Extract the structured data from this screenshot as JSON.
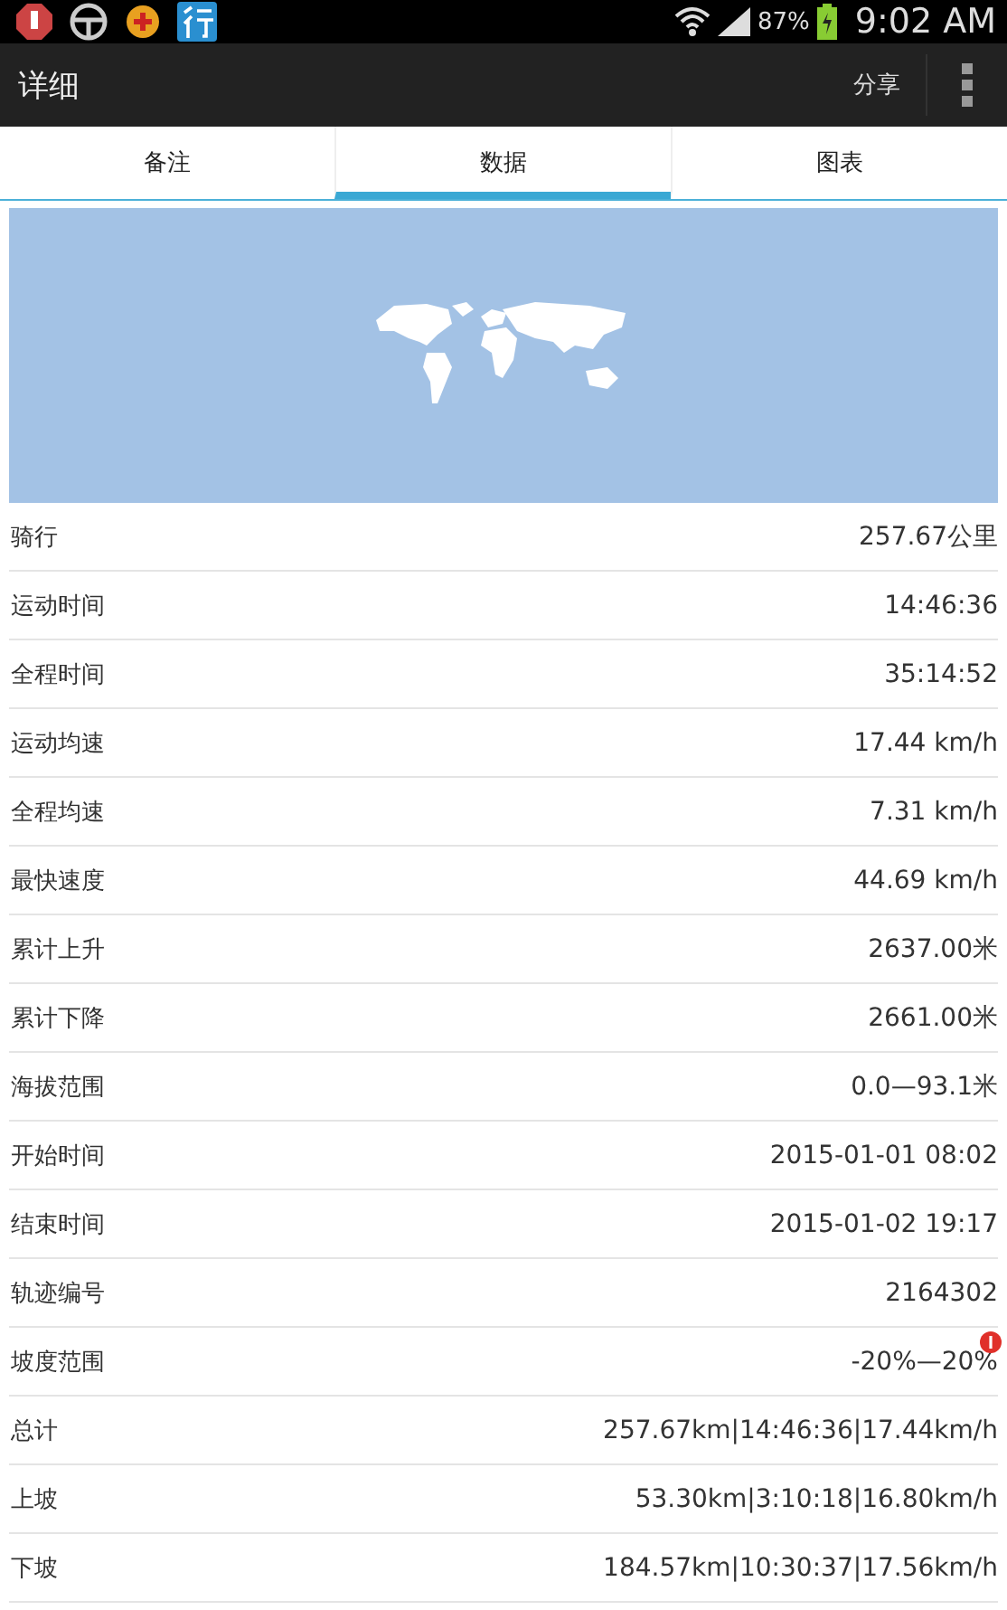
{
  "status_bar": {
    "battery": "87%",
    "time": "9:02 AM"
  },
  "action_bar": {
    "title": "详细",
    "share": "分享"
  },
  "tabs": [
    {
      "label": "备注",
      "selected": false
    },
    {
      "label": "数据",
      "selected": true
    },
    {
      "label": "图表",
      "selected": false
    }
  ],
  "rows": [
    {
      "label": "骑行",
      "value": "257.67公里"
    },
    {
      "label": "运动时间",
      "value": "14:46:36"
    },
    {
      "label": "全程时间",
      "value": "35:14:52"
    },
    {
      "label": "运动均速",
      "value": "17.44 km/h"
    },
    {
      "label": "全程均速",
      "value": "7.31 km/h"
    },
    {
      "label": "最快速度",
      "value": "44.69 km/h"
    },
    {
      "label": "累计上升",
      "value": "2637.00米"
    },
    {
      "label": "累计下降",
      "value": "2661.00米"
    },
    {
      "label": "海拔范围",
      "value": "0.0—93.1米"
    },
    {
      "label": "开始时间",
      "value": "2015-01-01 08:02"
    },
    {
      "label": "结束时间",
      "value": "2015-01-02 19:17"
    },
    {
      "label": "轨迹编号",
      "value": "2164302"
    },
    {
      "label": "坡度范围",
      "value": "-20%—20%"
    },
    {
      "label": "总计",
      "value": "257.67km|14:46:36|17.44km/h"
    },
    {
      "label": "上坡",
      "value": "53.30km|3:10:18|16.80km/h"
    },
    {
      "label": "下坡",
      "value": "184.57km|10:30:37|17.56km/h"
    }
  ]
}
